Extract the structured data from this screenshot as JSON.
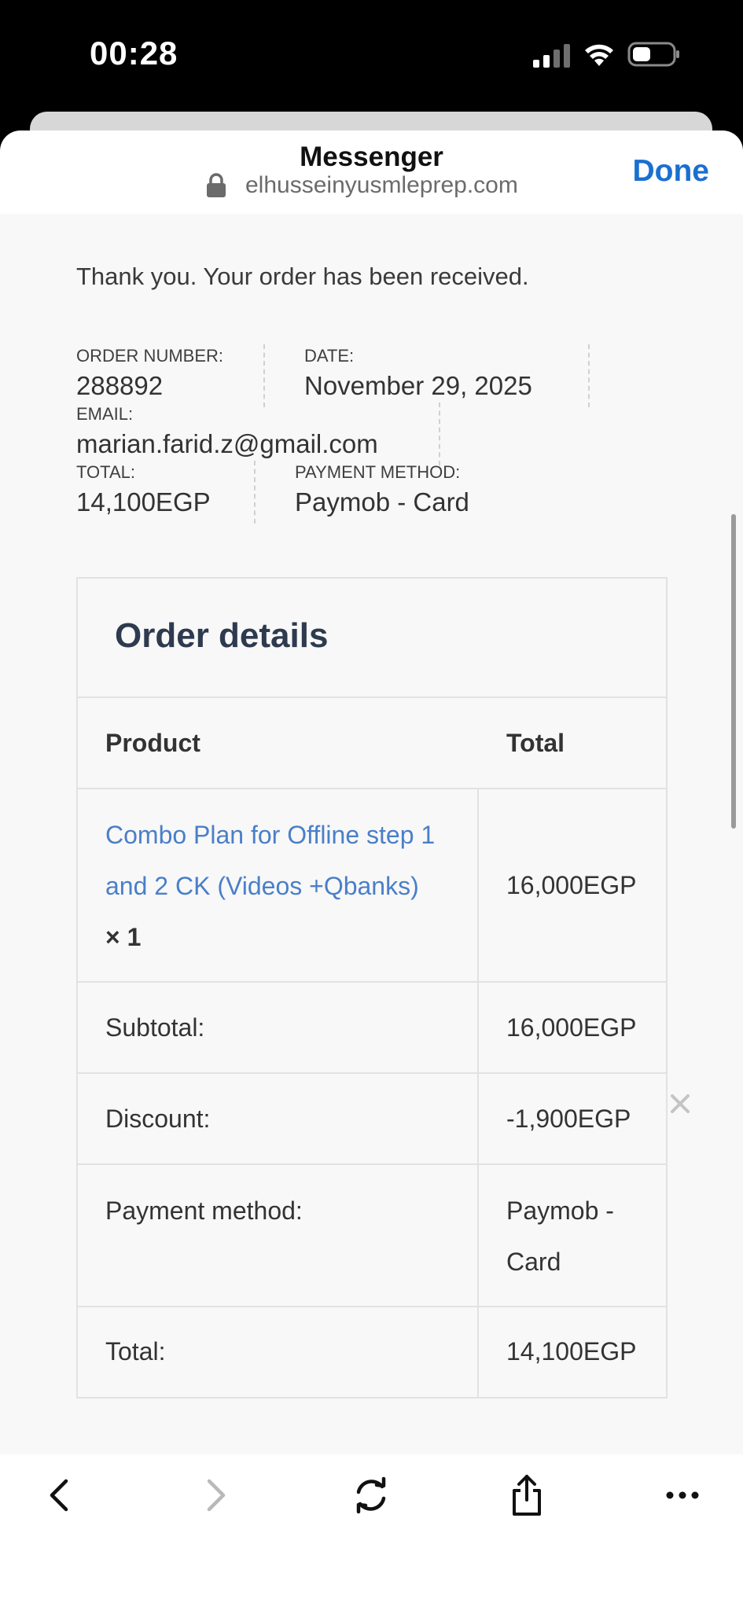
{
  "status_bar": {
    "time": "00:28"
  },
  "browser": {
    "title": "Messenger",
    "url": "elhusseinyusmleprep.com",
    "done_label": "Done"
  },
  "page": {
    "thank_you": "Thank you. Your order has been received.",
    "overview": {
      "order_number_label": "ORDER NUMBER:",
      "order_number": "288892",
      "date_label": "DATE:",
      "date": "November 29, 2025",
      "email_label": "EMAIL:",
      "email": "marian.farid.z@gmail.com",
      "total_label": "TOTAL:",
      "total": "14,100EGP",
      "payment_label": "PAYMENT METHOD:",
      "payment": "Paymob - Card"
    },
    "order_details": {
      "heading": "Order details",
      "col_product": "Product",
      "col_total": "Total",
      "product_line1": "Combo Plan for Offline step 1",
      "product_line2": "and 2 CK (Videos +Qbanks)",
      "product_qty": "× 1",
      "product_total": "16,000EGP",
      "subtotal_label": "Subtotal:",
      "subtotal": "16,000EGP",
      "discount_label": "Discount:",
      "discount": "-1,900EGP",
      "payment_label": "Payment method:",
      "payment_line1": "Paymob -",
      "payment_line2": "Card",
      "total_label": "Total:",
      "total": "14,100EGP"
    }
  },
  "icons": {
    "back": "chevron-left-icon",
    "forward": "chevron-right-icon",
    "reload": "reload-icon",
    "share": "share-icon",
    "more": "more-icon"
  },
  "colors": {
    "link": "#4a7fc9",
    "done": "#1a6fd1",
    "heading": "#2e3a4e"
  }
}
